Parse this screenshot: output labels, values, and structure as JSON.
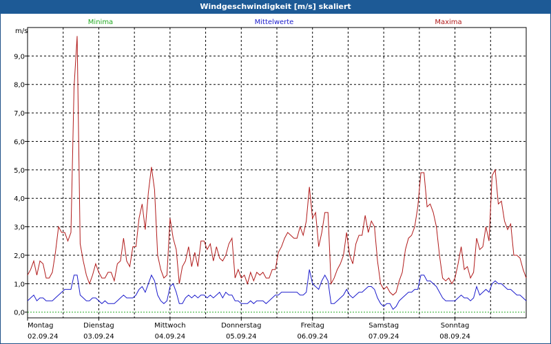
{
  "title": "Windgeschwindigkeit [m/s] skaliert",
  "legend": {
    "min": {
      "label": "Minima",
      "color": "#22aa22"
    },
    "mean": {
      "label": "Mittelwerte",
      "color": "#1a1acc"
    },
    "max": {
      "label": "Maxima",
      "color": "#b01818"
    }
  },
  "chart_data": {
    "type": "line",
    "title": "Windgeschwindigkeit [m/s] skaliert",
    "ylabel": "m/s",
    "ylim": [
      -0.2,
      10.0
    ],
    "yticks": [
      "0,0",
      "1,0",
      "2,0",
      "3,0",
      "4,0",
      "5,0",
      "6,0",
      "7,0",
      "8,0",
      "9,0"
    ],
    "ytick_values": [
      0,
      1,
      2,
      3,
      4,
      5,
      6,
      7,
      8,
      9
    ],
    "xlim": [
      0,
      7
    ],
    "x_labels": [
      {
        "day": "Montag",
        "date": "02.09.24"
      },
      {
        "day": "Dienstag",
        "date": "03.09.24"
      },
      {
        "day": "Mittwoch",
        "date": "04.09.24"
      },
      {
        "day": "Donnerstag",
        "date": "05.09.24"
      },
      {
        "day": "Freitag",
        "date": "06.09.24"
      },
      {
        "day": "Samstag",
        "date": "07.09.24"
      },
      {
        "day": "Sonntag",
        "date": "08.09.24"
      }
    ],
    "grid": true,
    "series": [
      {
        "name": "Maxima",
        "color": "#b01818",
        "values": [
          1.3,
          1.5,
          1.8,
          1.3,
          1.8,
          1.7,
          1.2,
          1.2,
          1.4,
          2.1,
          3.0,
          2.8,
          2.8,
          2.5,
          2.8,
          7.9,
          9.7,
          2.4,
          1.8,
          1.3,
          1.0,
          1.3,
          1.7,
          1.4,
          1.2,
          1.2,
          1.4,
          1.4,
          1.1,
          1.7,
          1.8,
          2.6,
          1.8,
          1.6,
          2.3,
          2.3,
          3.3,
          3.8,
          2.9,
          4.2,
          5.1,
          4.3,
          2.0,
          1.5,
          1.2,
          1.3,
          3.3,
          2.6,
          2.2,
          1.0,
          1.6,
          1.8,
          2.3,
          1.6,
          2.1,
          1.6,
          2.5,
          2.5,
          2.2,
          2.4,
          1.8,
          2.3,
          1.9,
          1.8,
          2.0,
          2.4,
          2.6,
          1.2,
          1.5,
          1.2,
          1.3,
          1.0,
          1.4,
          1.1,
          1.4,
          1.3,
          1.4,
          1.2,
          1.2,
          1.5,
          1.5,
          2.1,
          2.3,
          2.6,
          2.8,
          2.7,
          2.6,
          2.6,
          3.0,
          2.7,
          3.2,
          4.4,
          3.3,
          3.5,
          2.3,
          2.8,
          3.5,
          3.5,
          1.0,
          1.2,
          1.5,
          1.7,
          2.0,
          2.8,
          2.0,
          1.7,
          2.4,
          2.7,
          2.7,
          3.4,
          2.8,
          3.2,
          3.0,
          1.8,
          1.0,
          0.8,
          0.9,
          0.7,
          0.6,
          0.7,
          1.1,
          1.4,
          2.2,
          2.6,
          2.7,
          3.0,
          3.7,
          4.9,
          4.9,
          3.7,
          3.8,
          3.5,
          3.0,
          2.0,
          1.2,
          1.1,
          1.2,
          1.0,
          1.2,
          1.7,
          2.3,
          1.5,
          1.6,
          1.2,
          1.4,
          2.6,
          2.2,
          2.3,
          3.0,
          2.5,
          4.8,
          5.0,
          3.8,
          3.9,
          3.2,
          2.9,
          3.1,
          2.0,
          2.0,
          1.9,
          1.5,
          1.2
        ]
      },
      {
        "name": "Mittelwerte",
        "color": "#1a1acc",
        "values": [
          0.4,
          0.5,
          0.6,
          0.4,
          0.5,
          0.5,
          0.4,
          0.4,
          0.4,
          0.5,
          0.6,
          0.7,
          0.8,
          0.8,
          0.8,
          1.3,
          1.3,
          0.6,
          0.5,
          0.4,
          0.4,
          0.5,
          0.5,
          0.4,
          0.3,
          0.4,
          0.3,
          0.3,
          0.3,
          0.4,
          0.5,
          0.6,
          0.5,
          0.5,
          0.5,
          0.6,
          0.8,
          0.9,
          0.7,
          1.0,
          1.3,
          1.1,
          0.6,
          0.4,
          0.3,
          0.4,
          0.9,
          1.0,
          0.7,
          0.3,
          0.3,
          0.5,
          0.6,
          0.5,
          0.6,
          0.5,
          0.6,
          0.6,
          0.5,
          0.6,
          0.5,
          0.6,
          0.7,
          0.5,
          0.7,
          0.6,
          0.6,
          0.4,
          0.4,
          0.3,
          0.3,
          0.3,
          0.4,
          0.3,
          0.4,
          0.4,
          0.4,
          0.3,
          0.4,
          0.5,
          0.6,
          0.6,
          0.7,
          0.7,
          0.7,
          0.7,
          0.7,
          0.7,
          0.6,
          0.6,
          0.7,
          1.5,
          1.0,
          0.9,
          0.8,
          1.1,
          1.3,
          1.1,
          0.3,
          0.3,
          0.4,
          0.5,
          0.6,
          0.8,
          0.6,
          0.5,
          0.6,
          0.7,
          0.7,
          0.8,
          0.9,
          0.9,
          0.8,
          0.5,
          0.3,
          0.2,
          0.3,
          0.3,
          0.1,
          0.2,
          0.4,
          0.5,
          0.6,
          0.7,
          0.7,
          0.8,
          0.8,
          1.3,
          1.3,
          1.1,
          1.1,
          1.0,
          0.9,
          0.7,
          0.5,
          0.4,
          0.4,
          0.4,
          0.4,
          0.5,
          0.6,
          0.5,
          0.5,
          0.4,
          0.5,
          0.9,
          0.6,
          0.7,
          0.8,
          0.7,
          1.0,
          1.1,
          1.0,
          1.0,
          0.9,
          0.8,
          0.8,
          0.7,
          0.6,
          0.6,
          0.5,
          0.4
        ]
      },
      {
        "name": "Minima",
        "color": "#22aa22",
        "values": [
          0,
          0,
          0,
          0,
          0,
          0,
          0,
          0
        ]
      }
    ]
  }
}
